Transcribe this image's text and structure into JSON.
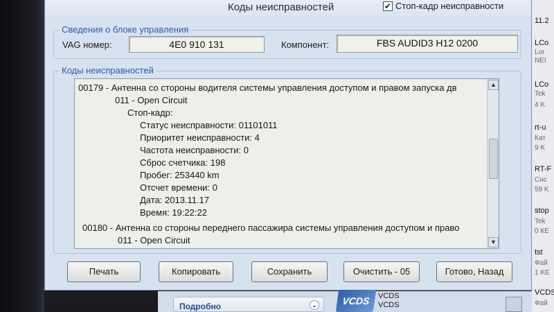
{
  "window": {
    "title": "Коды неисправностей",
    "freeze_frame_label": "Стоп-кадр неисправности",
    "freeze_frame_checked": true,
    "freeze_frame_mark": "✔"
  },
  "control_unit": {
    "group_title": "Сведения о блоке управления",
    "vag_label": "VAG номер:",
    "vag_value": "4E0 910 131",
    "component_label": "Компонент:",
    "component_value": "FBS AUDID3   H12 0200"
  },
  "fault_codes": {
    "group_title": "Коды неисправностей",
    "lines": [
      "00179 - Антенна со стороны водителя системы управления доступом и правом запуска дв",
      "011 - Open Circuit",
      "Стоп-кадр:",
      "Статус неисправности: 01101011",
      "Приоритет неисправности: 4",
      "Частота неисправности: 0",
      "Сброс счетчика: 198",
      "Пробег: 253440 km",
      "Отсчет времени: 0",
      "Дата: 2013.11.17",
      "Время: 19:22:22",
      "00180 - Антенна со стороны переднего пассажира системы управления доступом и право",
      "011 - Open Circuit"
    ]
  },
  "buttons": {
    "print": "Печать",
    "copy": "Копировать",
    "save": "Сохранить",
    "clear": "Очистить - 05",
    "done": "Готово, Назад"
  },
  "taskbar": {
    "details_label": "Подробно",
    "vcds_logo": "VCDS",
    "vcds_line1": "VCDS",
    "vcds_line2": "VCDS"
  },
  "right_pane": {
    "top_label": "11.2",
    "items": [
      {
        "name": "LCo",
        "sub1": "Lor",
        "sub2": "NEI"
      },
      {
        "name": "LCo",
        "sub1": "Tek",
        "sub2": "4 K"
      },
      {
        "name": "rt-u",
        "sub1": "Кат",
        "sub2": "9 K"
      },
      {
        "name": "RT-F",
        "sub1": "Снс",
        "sub2": "59 K"
      },
      {
        "name": "stop",
        "sub1": "Tek",
        "sub2": "0 КЕ"
      },
      {
        "name": "tst",
        "sub1": "Фай",
        "sub2": "1 KE"
      },
      {
        "name": "VCDS",
        "sub1": "Фай",
        "sub2": ""
      }
    ]
  }
}
